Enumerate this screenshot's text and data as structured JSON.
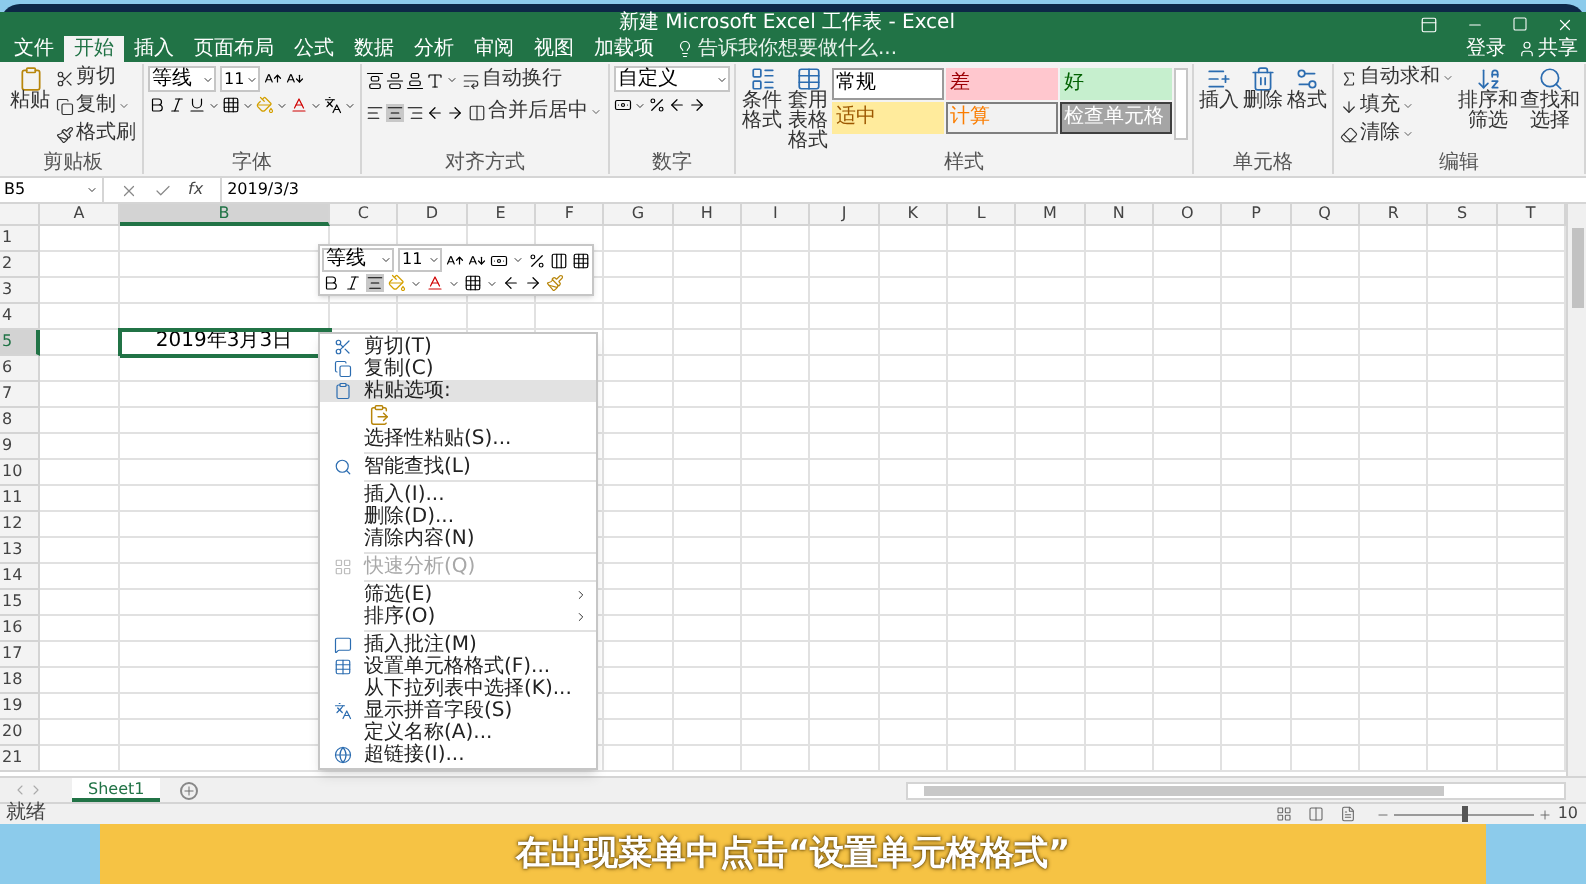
{
  "window": {
    "title": "新建 Microsoft Excel 工作表 - Excel"
  },
  "tabs": [
    {
      "label": "文件",
      "selected": false
    },
    {
      "label": "开始",
      "selected": true
    },
    {
      "label": "插入",
      "selected": false
    },
    {
      "label": "页面布局",
      "selected": false
    },
    {
      "label": "公式",
      "selected": false
    },
    {
      "label": "数据",
      "selected": false
    },
    {
      "label": "分析",
      "selected": false
    },
    {
      "label": "审阅",
      "selected": false
    },
    {
      "label": "视图",
      "selected": false
    },
    {
      "label": "加载项",
      "selected": false
    }
  ],
  "tell_me": {
    "placeholder": "告诉我你想要做什么..."
  },
  "account": {
    "sign_in": "登录",
    "share": "共享"
  },
  "ribbon": [
    {
      "kind": "clipboard",
      "label": "剪贴板",
      "paste": "粘贴",
      "buttons": [
        "剪切",
        "复制",
        "格式刷"
      ]
    },
    {
      "kind": "font",
      "label": "字体",
      "font": "等线",
      "size": "11"
    },
    {
      "kind": "alignment",
      "label": "对齐方式",
      "wrap": "自动换行",
      "merge": "合并后居中"
    },
    {
      "kind": "number",
      "label": "数字",
      "format": "自定义"
    },
    {
      "kind": "styles",
      "label": "样式",
      "buttons": [
        "条件格式",
        "套用表格格式"
      ],
      "gallery": [
        {
          "label": "常规",
          "kind": "normal"
        },
        {
          "label": "差",
          "kind": "bad"
        },
        {
          "label": "好",
          "kind": "good"
        },
        {
          "label": "适中",
          "kind": "neutral"
        },
        {
          "label": "计算",
          "kind": "calculation"
        },
        {
          "label": "检查单元格",
          "kind": "check"
        }
      ]
    },
    {
      "kind": "cells",
      "label": "单元格",
      "buttons": [
        "插入",
        "删除",
        "格式"
      ]
    },
    {
      "kind": "editing",
      "label": "编辑",
      "small": [
        "自动求和",
        "填充",
        "清除"
      ],
      "buttons": [
        "排序和筛选",
        "查找和选择"
      ]
    }
  ],
  "formula_bar": {
    "name_box": "B5",
    "function_label": "fx",
    "formula": "2019/3/3"
  },
  "sheet": {
    "columns": [
      {
        "label": "A",
        "selected": false
      },
      {
        "label": "B",
        "selected": true
      },
      {
        "label": "C",
        "selected": false
      },
      {
        "label": "D",
        "selected": false
      },
      {
        "label": "E",
        "selected": false
      },
      {
        "label": "F",
        "selected": false
      },
      {
        "label": "G",
        "selected": false
      },
      {
        "label": "H",
        "selected": false
      },
      {
        "label": "I",
        "selected": false
      },
      {
        "label": "J",
        "selected": false
      },
      {
        "label": "K",
        "selected": false
      },
      {
        "label": "L",
        "selected": false
      },
      {
        "label": "M",
        "selected": false
      },
      {
        "label": "N",
        "selected": false
      },
      {
        "label": "O",
        "selected": false
      },
      {
        "label": "P",
        "selected": false
      },
      {
        "label": "Q",
        "selected": false
      },
      {
        "label": "R",
        "selected": false
      },
      {
        "label": "S",
        "selected": false
      },
      {
        "label": "T",
        "selected": false
      }
    ],
    "rows": [
      {
        "label": "1",
        "selected": false
      },
      {
        "label": "2",
        "selected": false
      },
      {
        "label": "3",
        "selected": false
      },
      {
        "label": "4",
        "selected": false
      },
      {
        "label": "5",
        "selected": true,
        "cells": [
          null,
          {
            "value": "2019年3月3日",
            "selected": true
          }
        ]
      },
      {
        "label": "6",
        "selected": false
      },
      {
        "label": "7",
        "selected": false
      },
      {
        "label": "8",
        "selected": false
      },
      {
        "label": "9",
        "selected": false
      },
      {
        "label": "10",
        "selected": false
      },
      {
        "label": "11",
        "selected": false
      },
      {
        "label": "12",
        "selected": false
      },
      {
        "label": "13",
        "selected": false
      },
      {
        "label": "14",
        "selected": false
      },
      {
        "label": "15",
        "selected": false
      },
      {
        "label": "16",
        "selected": false
      },
      {
        "label": "17",
        "selected": false
      },
      {
        "label": "18",
        "selected": false
      },
      {
        "label": "19",
        "selected": false
      },
      {
        "label": "20",
        "selected": false
      },
      {
        "label": "21",
        "selected": false
      }
    ]
  },
  "mini_toolbar": {
    "font": "等线",
    "size": "11"
  },
  "context_menu": {
    "items": [
      {
        "kind": "item",
        "label": "剪切(T)",
        "selected": false,
        "disabled": false
      },
      {
        "kind": "item",
        "label": "复制(C)",
        "selected": false,
        "disabled": false
      },
      {
        "kind": "item",
        "label": "粘贴选项:",
        "selected": true,
        "disabled": false
      },
      {
        "kind": "paste_options"
      },
      {
        "kind": "item",
        "label": "选择性粘贴(S)...",
        "selected": false,
        "disabled": false
      },
      {
        "kind": "separator"
      },
      {
        "kind": "item",
        "label": "智能查找(L)",
        "selected": false,
        "disabled": false
      },
      {
        "kind": "separator"
      },
      {
        "kind": "item",
        "label": "插入(I)...",
        "selected": false,
        "disabled": false
      },
      {
        "kind": "item",
        "label": "删除(D)...",
        "selected": false,
        "disabled": false
      },
      {
        "kind": "item",
        "label": "清除内容(N)",
        "selected": false,
        "disabled": false
      },
      {
        "kind": "separator"
      },
      {
        "kind": "item",
        "label": "快速分析(Q)",
        "selected": false,
        "disabled": true
      },
      {
        "kind": "separator"
      },
      {
        "kind": "submenu",
        "label": "筛选(E)",
        "selected": false,
        "disabled": false
      },
      {
        "kind": "submenu",
        "label": "排序(O)",
        "selected": false,
        "disabled": false
      },
      {
        "kind": "separator"
      },
      {
        "kind": "item",
        "label": "插入批注(M)",
        "selected": false,
        "disabled": false
      },
      {
        "kind": "item",
        "label": "设置单元格格式(F)...",
        "selected": false,
        "disabled": false
      },
      {
        "kind": "item",
        "label": "从下拉列表中选择(K)...",
        "selected": false,
        "disabled": false
      },
      {
        "kind": "item",
        "label": "显示拼音字段(S)",
        "selected": false,
        "disabled": false
      },
      {
        "kind": "item",
        "label": "定义名称(A)...",
        "selected": false,
        "disabled": false
      },
      {
        "kind": "item",
        "label": "超链接(I)...",
        "selected": false,
        "disabled": false
      }
    ]
  },
  "sheet_tabs": [
    {
      "label": "Sheet1",
      "selected": true
    }
  ],
  "status_bar": {
    "status": "就绪",
    "zoom_slider": {
      "level": 0.5
    },
    "zoom": "10"
  },
  "subtitle": "在出现菜单中点击“设置单元格格式”"
}
